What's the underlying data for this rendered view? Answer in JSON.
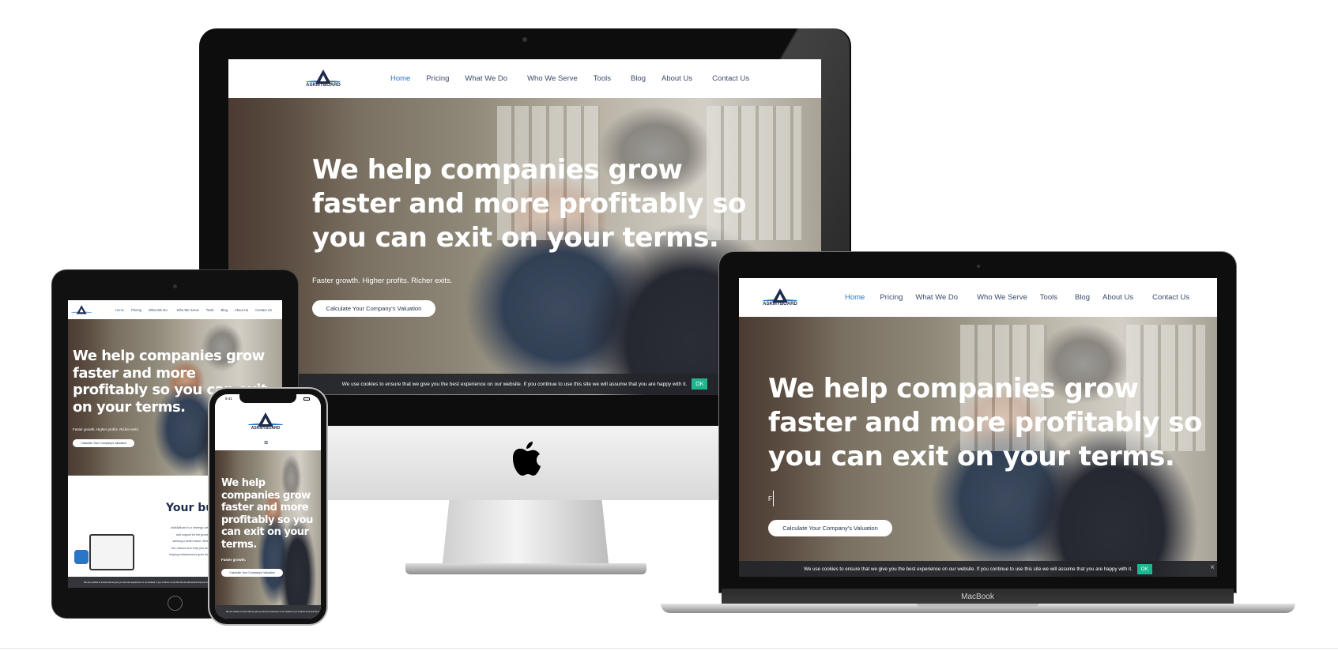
{
  "logo_text": "ASKMYBOARD",
  "nav": [
    "Home",
    "Pricing",
    "What We Do",
    "Who We Serve",
    "Tools",
    "Blog",
    "About Us",
    "Contact Us"
  ],
  "hero": {
    "headline": "We help companies grow faster and more profitably so you can exit on your terms.",
    "subtitle": "Faster growth. Higher profits. Richer exits.",
    "subtitle_laptop": "F",
    "subtitle_phone": "Faster growth.",
    "cta": "Calculate Your Company's Valuation"
  },
  "cookie": {
    "text": "We use cookies to ensure that we give you the best experience on our website. If you continue to use this site we will assume that you are happy with it.",
    "ok": "OK",
    "close": "×"
  },
  "tablet_section": {
    "heading": "Your bus",
    "lines": [
      "AskMyBoard is a strategic advisory",
      "and support for the growth",
      "seeking a better future. Whether",
      "Our mission is to help you achieve",
      "helping entrepreneurs grow their com"
    ]
  },
  "phone": {
    "time": "9:41",
    "menu_icon": "≡"
  },
  "laptop_brand": "MacBook",
  "colors": {
    "accent": "#2a76c6",
    "brand_navy": "#1d2c4c",
    "cookie_ok": "#1fb58f"
  }
}
